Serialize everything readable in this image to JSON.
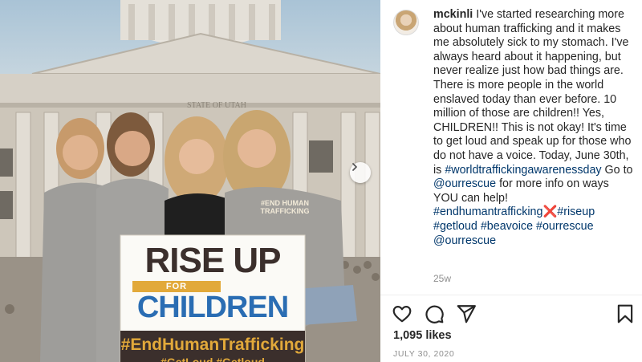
{
  "photo": {
    "sign_line1": "RISE UP",
    "sign_for": "FOR",
    "sign_line2": "CHILDREN",
    "sign_hashtag": "#EndHumanTrafficking",
    "sign_hashtag2": "#GetLoud  #Getloud",
    "building_inscription": "STATE OF UTAH",
    "shirt_text": "#END HUMAN TRAFFICKING",
    "next_icon": "chevron-right-icon"
  },
  "post": {
    "username": "mckinli",
    "caption_parts": [
      "I've started researching more about human trafficking and it makes me absolutely sick to my stomach. I've always heard about it happening, but never realize just how bad things are. There is more people in the world enslaved today than ever before. 10 million of those are children!! Yes, CHILDREN!! This is not okay! It's time to get loud and speak up for those who do not have a voice. Today, June 30th, is ",
      "#worldtraffickingawarenessday",
      " Go to ",
      "@ourrescue",
      " for more info on ways YOU can help! ",
      "#endhumantrafficking",
      "❌",
      " ",
      "#riseup",
      " ",
      "#getloud",
      " ",
      "#beavoice",
      " ",
      "#ourrescue",
      " ",
      "@ourrescue"
    ],
    "age": "25w",
    "likes": "1,095 likes",
    "date": "JULY 30, 2020"
  },
  "icons": {
    "like": "heart-icon",
    "comment": "comment-bubble-icon",
    "share": "paper-plane-icon",
    "save": "bookmark-icon"
  },
  "colors": {
    "link": "#00376b",
    "text": "#262626",
    "muted": "#8e8e8e",
    "sign_orange": "#e2a93a",
    "sign_blue": "#2a6db3",
    "sign_dark": "#3b2f2c"
  }
}
